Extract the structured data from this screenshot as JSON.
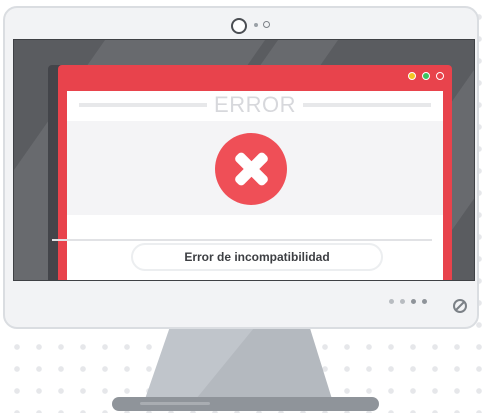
{
  "window": {
    "title": "ERROR",
    "controls": [
      "minimize-dot",
      "maximize-dot",
      "close-dot"
    ]
  },
  "message": {
    "text": "Error de incompatibilidad"
  },
  "icons": {
    "error": "error-x-icon",
    "camera": "camera-icon",
    "power": "power-icon"
  },
  "colors": {
    "window_frame": "#e8434c",
    "error_icon": "#ef4f57",
    "screen": "#5a5c60",
    "monitor_body": "#f2f3f5",
    "stand": "#c0c5cb",
    "window_control_yellow": "#f3c623",
    "window_control_green": "#3cc35f",
    "window_control_red": "#e8434c"
  }
}
